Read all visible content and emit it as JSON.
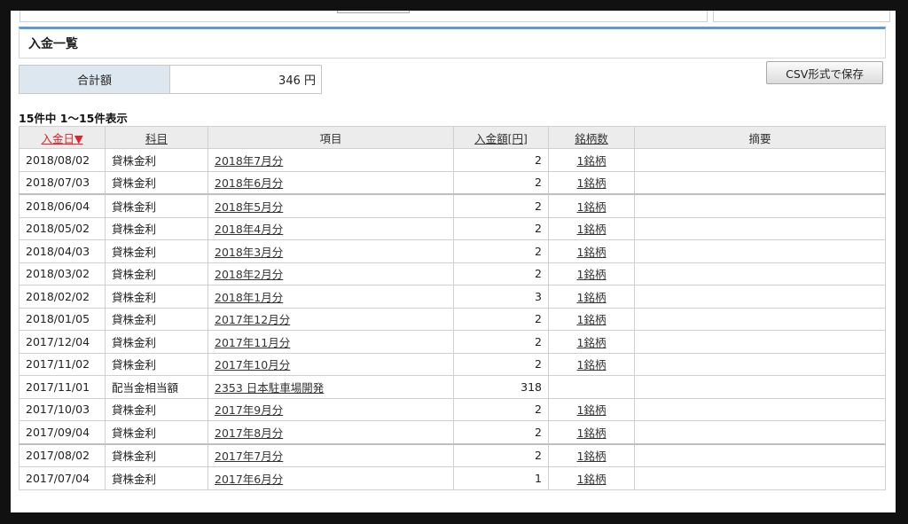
{
  "section": {
    "title": "入金一覧"
  },
  "summary": {
    "label": "合計額",
    "value": "346 円"
  },
  "csv_button": "CSV形式で保存",
  "count_text": "15件中 1〜15件表示",
  "table": {
    "headers": {
      "date": "入金日▼",
      "subject": "科目",
      "item": "項目",
      "amount": "入金額[円]",
      "stocks": "銘柄数",
      "summary": "摘要"
    },
    "rows": [
      {
        "date": "2018/08/02",
        "subject": "貸株金利",
        "item": "2018年7月分",
        "amount": "2",
        "stocks": "1銘柄",
        "note": ""
      },
      {
        "date": "2018/07/03",
        "subject": "貸株金利",
        "item": "2018年6月分",
        "amount": "2",
        "stocks": "1銘柄",
        "note": ""
      },
      {
        "date": "2018/06/04",
        "subject": "貸株金利",
        "item": "2018年5月分",
        "amount": "2",
        "stocks": "1銘柄",
        "note": ""
      },
      {
        "date": "2018/05/02",
        "subject": "貸株金利",
        "item": "2018年4月分",
        "amount": "2",
        "stocks": "1銘柄",
        "note": ""
      },
      {
        "date": "2018/04/03",
        "subject": "貸株金利",
        "item": "2018年3月分",
        "amount": "2",
        "stocks": "1銘柄",
        "note": ""
      },
      {
        "date": "2018/03/02",
        "subject": "貸株金利",
        "item": "2018年2月分",
        "amount": "2",
        "stocks": "1銘柄",
        "note": ""
      },
      {
        "date": "2018/02/02",
        "subject": "貸株金利",
        "item": "2018年1月分",
        "amount": "3",
        "stocks": "1銘柄",
        "note": ""
      },
      {
        "date": "2018/01/05",
        "subject": "貸株金利",
        "item": "2017年12月分",
        "amount": "2",
        "stocks": "1銘柄",
        "note": ""
      },
      {
        "date": "2017/12/04",
        "subject": "貸株金利",
        "item": "2017年11月分",
        "amount": "2",
        "stocks": "1銘柄",
        "note": ""
      },
      {
        "date": "2017/11/02",
        "subject": "貸株金利",
        "item": "2017年10月分",
        "amount": "2",
        "stocks": "1銘柄",
        "note": ""
      },
      {
        "date": "2017/11/01",
        "subject": "配当金相当額",
        "item": "2353 日本駐車場開発",
        "amount": "318",
        "stocks": "",
        "note": ""
      },
      {
        "date": "2017/10/03",
        "subject": "貸株金利",
        "item": "2017年9月分",
        "amount": "2",
        "stocks": "1銘柄",
        "note": ""
      },
      {
        "date": "2017/09/04",
        "subject": "貸株金利",
        "item": "2017年8月分",
        "amount": "2",
        "stocks": "1銘柄",
        "note": ""
      },
      {
        "date": "2017/08/02",
        "subject": "貸株金利",
        "item": "2017年7月分",
        "amount": "2",
        "stocks": "1銘柄",
        "note": ""
      },
      {
        "date": "2017/07/04",
        "subject": "貸株金利",
        "item": "2017年6月分",
        "amount": "1",
        "stocks": "1銘柄",
        "note": ""
      }
    ]
  },
  "colors": {
    "accent": "#5b9bd5",
    "sort_active": "#e0242a",
    "label_bg": "#dde7f0"
  }
}
